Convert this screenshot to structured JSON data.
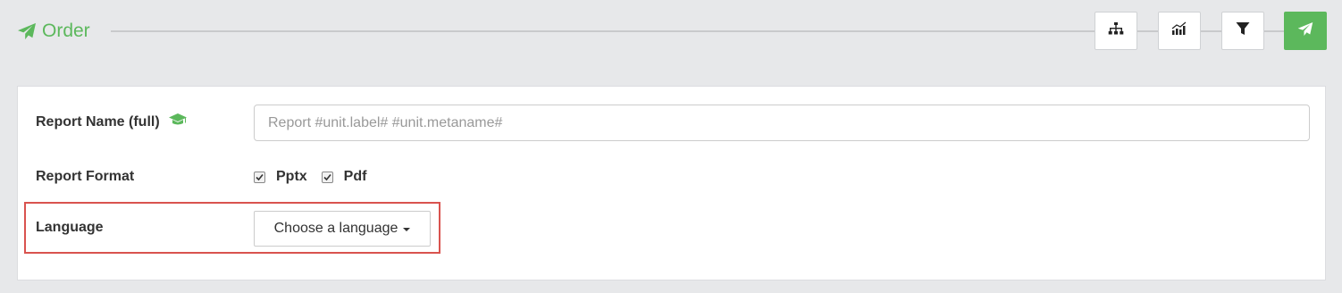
{
  "header": {
    "title": "Order",
    "icons": [
      "paper-plane-icon",
      "sitemap-icon",
      "bar-chart-icon",
      "filter-icon",
      "paper-plane-icon"
    ],
    "accent_color": "#5cb85c"
  },
  "form": {
    "report_name": {
      "label": "Report Name (full)",
      "icon": "graduation-cap-icon",
      "placeholder": "Report #unit.label# #unit.metaname#",
      "value": ""
    },
    "report_format": {
      "label": "Report Format",
      "options": [
        {
          "label": "Pptx",
          "checked": true
        },
        {
          "label": "Pdf",
          "checked": true
        }
      ]
    },
    "language": {
      "label": "Language",
      "selected": "Choose a language"
    }
  },
  "highlight_color": "#d9534f"
}
